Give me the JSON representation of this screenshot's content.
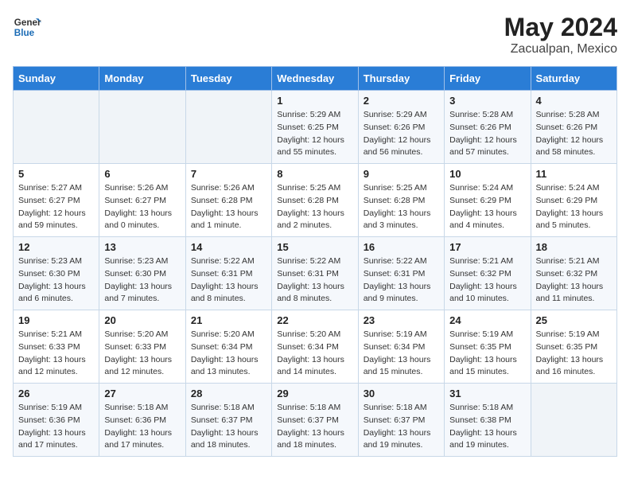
{
  "header": {
    "logo_general": "General",
    "logo_blue": "Blue",
    "month_year": "May 2024",
    "location": "Zacualpan, Mexico"
  },
  "weekdays": [
    "Sunday",
    "Monday",
    "Tuesday",
    "Wednesday",
    "Thursday",
    "Friday",
    "Saturday"
  ],
  "weeks": [
    [
      {
        "day": "",
        "info": ""
      },
      {
        "day": "",
        "info": ""
      },
      {
        "day": "",
        "info": ""
      },
      {
        "day": "1",
        "info": "Sunrise: 5:29 AM\nSunset: 6:25 PM\nDaylight: 12 hours\nand 55 minutes."
      },
      {
        "day": "2",
        "info": "Sunrise: 5:29 AM\nSunset: 6:26 PM\nDaylight: 12 hours\nand 56 minutes."
      },
      {
        "day": "3",
        "info": "Sunrise: 5:28 AM\nSunset: 6:26 PM\nDaylight: 12 hours\nand 57 minutes."
      },
      {
        "day": "4",
        "info": "Sunrise: 5:28 AM\nSunset: 6:26 PM\nDaylight: 12 hours\nand 58 minutes."
      }
    ],
    [
      {
        "day": "5",
        "info": "Sunrise: 5:27 AM\nSunset: 6:27 PM\nDaylight: 12 hours\nand 59 minutes."
      },
      {
        "day": "6",
        "info": "Sunrise: 5:26 AM\nSunset: 6:27 PM\nDaylight: 13 hours\nand 0 minutes."
      },
      {
        "day": "7",
        "info": "Sunrise: 5:26 AM\nSunset: 6:28 PM\nDaylight: 13 hours\nand 1 minute."
      },
      {
        "day": "8",
        "info": "Sunrise: 5:25 AM\nSunset: 6:28 PM\nDaylight: 13 hours\nand 2 minutes."
      },
      {
        "day": "9",
        "info": "Sunrise: 5:25 AM\nSunset: 6:28 PM\nDaylight: 13 hours\nand 3 minutes."
      },
      {
        "day": "10",
        "info": "Sunrise: 5:24 AM\nSunset: 6:29 PM\nDaylight: 13 hours\nand 4 minutes."
      },
      {
        "day": "11",
        "info": "Sunrise: 5:24 AM\nSunset: 6:29 PM\nDaylight: 13 hours\nand 5 minutes."
      }
    ],
    [
      {
        "day": "12",
        "info": "Sunrise: 5:23 AM\nSunset: 6:30 PM\nDaylight: 13 hours\nand 6 minutes."
      },
      {
        "day": "13",
        "info": "Sunrise: 5:23 AM\nSunset: 6:30 PM\nDaylight: 13 hours\nand 7 minutes."
      },
      {
        "day": "14",
        "info": "Sunrise: 5:22 AM\nSunset: 6:31 PM\nDaylight: 13 hours\nand 8 minutes."
      },
      {
        "day": "15",
        "info": "Sunrise: 5:22 AM\nSunset: 6:31 PM\nDaylight: 13 hours\nand 8 minutes."
      },
      {
        "day": "16",
        "info": "Sunrise: 5:22 AM\nSunset: 6:31 PM\nDaylight: 13 hours\nand 9 minutes."
      },
      {
        "day": "17",
        "info": "Sunrise: 5:21 AM\nSunset: 6:32 PM\nDaylight: 13 hours\nand 10 minutes."
      },
      {
        "day": "18",
        "info": "Sunrise: 5:21 AM\nSunset: 6:32 PM\nDaylight: 13 hours\nand 11 minutes."
      }
    ],
    [
      {
        "day": "19",
        "info": "Sunrise: 5:21 AM\nSunset: 6:33 PM\nDaylight: 13 hours\nand 12 minutes."
      },
      {
        "day": "20",
        "info": "Sunrise: 5:20 AM\nSunset: 6:33 PM\nDaylight: 13 hours\nand 12 minutes."
      },
      {
        "day": "21",
        "info": "Sunrise: 5:20 AM\nSunset: 6:34 PM\nDaylight: 13 hours\nand 13 minutes."
      },
      {
        "day": "22",
        "info": "Sunrise: 5:20 AM\nSunset: 6:34 PM\nDaylight: 13 hours\nand 14 minutes."
      },
      {
        "day": "23",
        "info": "Sunrise: 5:19 AM\nSunset: 6:34 PM\nDaylight: 13 hours\nand 15 minutes."
      },
      {
        "day": "24",
        "info": "Sunrise: 5:19 AM\nSunset: 6:35 PM\nDaylight: 13 hours\nand 15 minutes."
      },
      {
        "day": "25",
        "info": "Sunrise: 5:19 AM\nSunset: 6:35 PM\nDaylight: 13 hours\nand 16 minutes."
      }
    ],
    [
      {
        "day": "26",
        "info": "Sunrise: 5:19 AM\nSunset: 6:36 PM\nDaylight: 13 hours\nand 17 minutes."
      },
      {
        "day": "27",
        "info": "Sunrise: 5:18 AM\nSunset: 6:36 PM\nDaylight: 13 hours\nand 17 minutes."
      },
      {
        "day": "28",
        "info": "Sunrise: 5:18 AM\nSunset: 6:37 PM\nDaylight: 13 hours\nand 18 minutes."
      },
      {
        "day": "29",
        "info": "Sunrise: 5:18 AM\nSunset: 6:37 PM\nDaylight: 13 hours\nand 18 minutes."
      },
      {
        "day": "30",
        "info": "Sunrise: 5:18 AM\nSunset: 6:37 PM\nDaylight: 13 hours\nand 19 minutes."
      },
      {
        "day": "31",
        "info": "Sunrise: 5:18 AM\nSunset: 6:38 PM\nDaylight: 13 hours\nand 19 minutes."
      },
      {
        "day": "",
        "info": ""
      }
    ]
  ]
}
